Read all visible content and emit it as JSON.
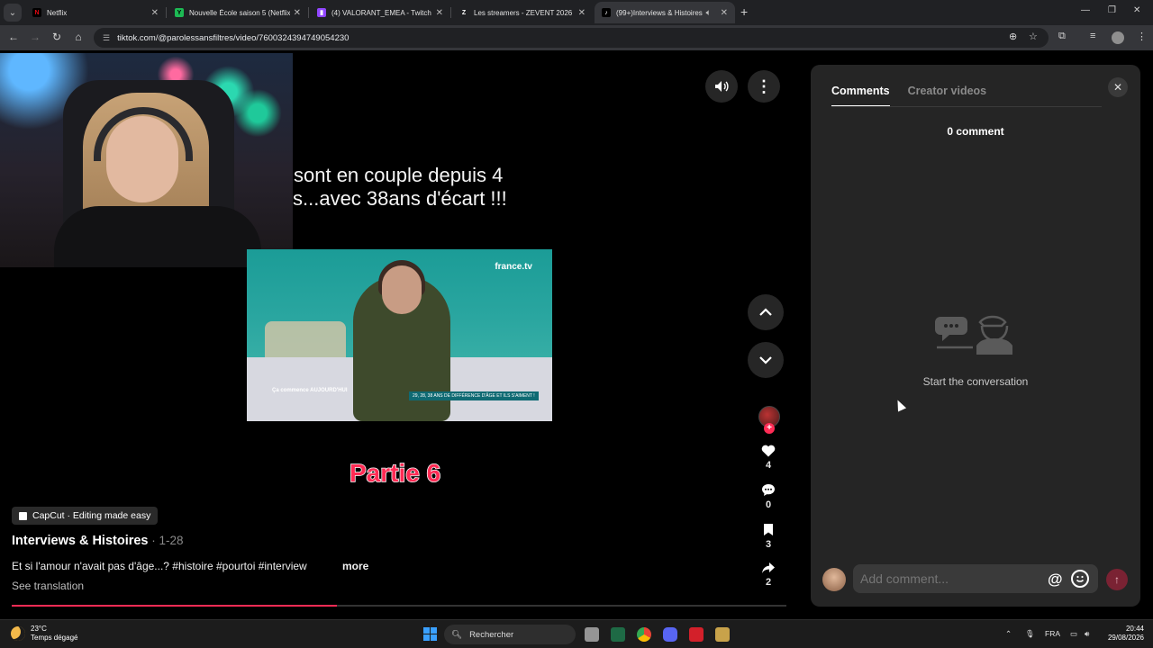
{
  "browser": {
    "tabs": [
      {
        "title": "Netflix",
        "favicon": "netflix-icon",
        "color": "#e50914",
        "active": false
      },
      {
        "title": "Nouvelle École saison 5 (Netflix)",
        "favicon": "y-icon",
        "color": "#1db954",
        "active": false
      },
      {
        "title": "(4) VALORANT_EMEA - Twitch",
        "favicon": "twitch-icon",
        "color": "#9146ff",
        "active": false
      },
      {
        "title": "Les streamers - ZEVENT 2026",
        "favicon": "zevent-icon",
        "color": "#ffffff",
        "active": false
      },
      {
        "title": "(99+)Interviews & Histoires",
        "favicon": "tiktok-icon",
        "color": "#ffffff",
        "active": true
      }
    ],
    "url": "tiktok.com/@parolessansfiltres/video/7600324394749054230"
  },
  "video": {
    "overlay_caption_line1": "sont en couple depuis 4",
    "overlay_caption_line2": "s...avec 38ans d'écart !!!",
    "frame_logo": "france.tv",
    "frame_show": "Ça commence AUJOURD'HUI",
    "frame_banner": "29, 28, 38 ANS DE DIFFÉRENCE D'ÂGE ET ILS S'AIMENT !",
    "part_label": "Partie 6",
    "capcut_label": "CapCut · Editing made easy",
    "title": "Interviews & Histoires",
    "date": " · 1-28",
    "description": "Et si l'amour n'avait pas d'âge...? #histoire #pourtoi #interview",
    "more_label": "more",
    "translate_label": "See translation",
    "progress_fraction": 0.42
  },
  "actions": {
    "likes": "4",
    "comments": "0",
    "saves": "3",
    "shares": "2"
  },
  "comments_panel": {
    "tabs": [
      "Comments",
      "Creator videos"
    ],
    "count_label": "0 comment",
    "empty_label": "Start the conversation",
    "input_placeholder": "Add comment...",
    "mention_symbol": "@"
  },
  "taskbar": {
    "temperature": "23°C",
    "weather": "Temps dégagé",
    "search_label": "Rechercher",
    "language": "FRA",
    "time": "20:44",
    "date": "29/08/2026"
  },
  "colors": {
    "accent": "#fe2c55",
    "panel_bg": "#252525"
  }
}
